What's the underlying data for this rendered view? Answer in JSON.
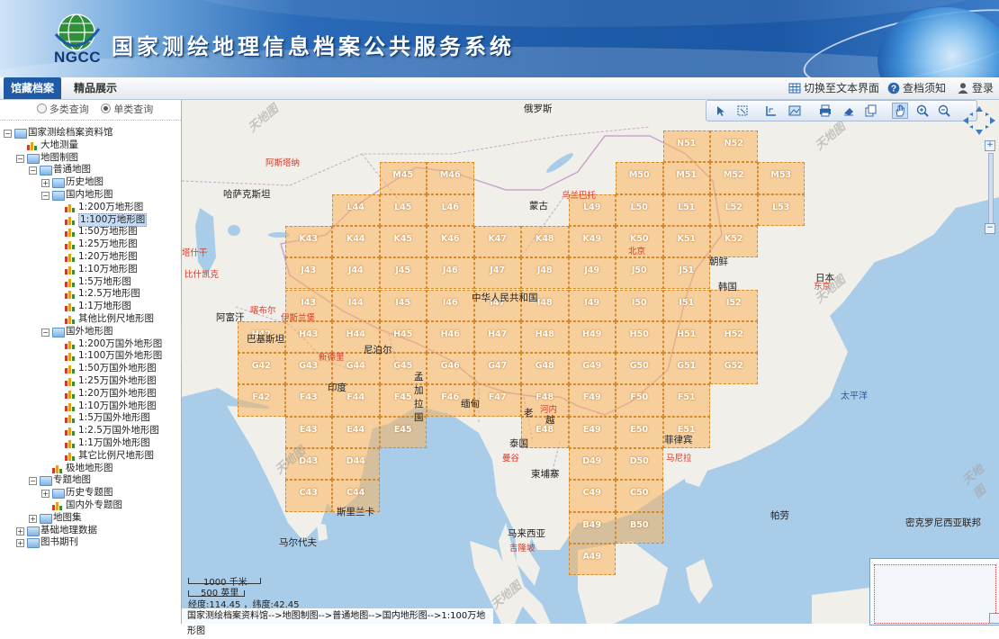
{
  "header": {
    "logo_text": "NGCC",
    "title": "国家测绘地理信息档案公共服务系统"
  },
  "nav": {
    "tabs": [
      "馆藏档案",
      "精品展示"
    ],
    "active_tab": "馆藏档案",
    "switch_text_view": "切换至文本界面",
    "notice": "查档须知",
    "login": "登录"
  },
  "query_mode": {
    "options": [
      "多类查询",
      "单类查询"
    ],
    "selected": "单类查询"
  },
  "tree": [
    {
      "label": "国家测绘档案资料馆",
      "depth": 0,
      "type": "folder",
      "expander": "−"
    },
    {
      "label": "大地测量",
      "depth": 1,
      "type": "map"
    },
    {
      "label": "地图制图",
      "depth": 1,
      "type": "folder",
      "expander": "−"
    },
    {
      "label": "普通地图",
      "depth": 2,
      "type": "folder",
      "expander": "−"
    },
    {
      "label": "历史地图",
      "depth": 3,
      "type": "folder",
      "expander": "+"
    },
    {
      "label": "国内地形图",
      "depth": 3,
      "type": "folder",
      "expander": "−"
    },
    {
      "label": "1:200万地形图",
      "depth": 4,
      "type": "map"
    },
    {
      "label": "1:100万地形图",
      "depth": 4,
      "type": "map",
      "selected": true
    },
    {
      "label": "1:50万地形图",
      "depth": 4,
      "type": "map"
    },
    {
      "label": "1:25万地形图",
      "depth": 4,
      "type": "map"
    },
    {
      "label": "1:20万地形图",
      "depth": 4,
      "type": "map"
    },
    {
      "label": "1:10万地形图",
      "depth": 4,
      "type": "map"
    },
    {
      "label": "1:5万地形图",
      "depth": 4,
      "type": "map"
    },
    {
      "label": "1:2.5万地形图",
      "depth": 4,
      "type": "map"
    },
    {
      "label": "1:1万地形图",
      "depth": 4,
      "type": "map"
    },
    {
      "label": "其他比例尺地形图",
      "depth": 4,
      "type": "map"
    },
    {
      "label": "国外地形图",
      "depth": 3,
      "type": "folder",
      "expander": "−"
    },
    {
      "label": "1:200万国外地形图",
      "depth": 4,
      "type": "map"
    },
    {
      "label": "1:100万国外地形图",
      "depth": 4,
      "type": "map"
    },
    {
      "label": "1:50万国外地形图",
      "depth": 4,
      "type": "map"
    },
    {
      "label": "1:25万国外地形图",
      "depth": 4,
      "type": "map"
    },
    {
      "label": "1:20万国外地形图",
      "depth": 4,
      "type": "map"
    },
    {
      "label": "1:10万国外地形图",
      "depth": 4,
      "type": "map"
    },
    {
      "label": "1:5万国外地形图",
      "depth": 4,
      "type": "map"
    },
    {
      "label": "1:2.5万国外地形图",
      "depth": 4,
      "type": "map"
    },
    {
      "label": "1:1万国外地形图",
      "depth": 4,
      "type": "map"
    },
    {
      "label": "其它比例尺地形图",
      "depth": 4,
      "type": "map"
    },
    {
      "label": "极地地形图",
      "depth": 3,
      "type": "map"
    },
    {
      "label": "专题地图",
      "depth": 2,
      "type": "folder",
      "expander": "−"
    },
    {
      "label": "历史专题图",
      "depth": 3,
      "type": "folder",
      "expander": "+"
    },
    {
      "label": "国内外专题图",
      "depth": 3,
      "type": "map"
    },
    {
      "label": "地图集",
      "depth": 2,
      "type": "folder",
      "expander": "+"
    },
    {
      "label": "基础地理数据",
      "depth": 1,
      "type": "folder",
      "expander": "+"
    },
    {
      "label": "图书期刊",
      "depth": 1,
      "type": "folder",
      "expander": "+"
    }
  ],
  "map": {
    "sheet_rows": [
      {
        "row": "N",
        "cols": [
          51,
          52
        ]
      },
      {
        "row": "M",
        "cols": [
          45,
          46,
          50,
          51,
          52,
          53
        ]
      },
      {
        "row": "L",
        "cols": [
          44,
          45,
          46,
          49,
          50,
          51,
          52,
          53
        ]
      },
      {
        "row": "K",
        "cols": [
          43,
          44,
          45,
          46,
          47,
          48,
          49,
          50,
          51,
          52
        ]
      },
      {
        "row": "J",
        "cols": [
          43,
          44,
          45,
          46,
          47,
          48,
          49,
          50,
          51
        ]
      },
      {
        "row": "I",
        "cols": [
          43,
          44,
          45,
          46,
          47,
          48,
          49,
          50,
          51,
          52
        ]
      },
      {
        "row": "H",
        "cols": [
          42,
          43,
          44,
          45,
          46,
          47,
          48,
          49,
          50,
          51,
          52
        ]
      },
      {
        "row": "G",
        "cols": [
          42,
          43,
          44,
          45,
          46,
          47,
          48,
          49,
          50,
          51,
          52
        ]
      },
      {
        "row": "F",
        "cols": [
          42,
          43,
          44,
          45,
          46,
          47,
          48,
          49,
          50,
          51
        ]
      },
      {
        "row": "E",
        "cols": [
          43,
          44,
          45,
          48,
          49,
          50,
          51
        ]
      },
      {
        "row": "D",
        "cols": [
          43,
          44,
          49,
          50
        ]
      },
      {
        "row": "C",
        "cols": [
          43,
          44,
          49,
          50
        ]
      },
      {
        "row": "B",
        "cols": [
          49,
          50
        ]
      },
      {
        "row": "A",
        "cols": [
          49
        ]
      }
    ],
    "place_names": {
      "russia": "俄罗斯",
      "astana": "阿斯塔纳",
      "kazakhstan": "哈萨克斯坦",
      "mongolia": "蒙古",
      "ulaanbaatar": "乌兰巴托",
      "bishkek": "比什凯克",
      "china": "中华人民共和国",
      "beijing": "北京",
      "korea": "朝鲜",
      "rok": "韩国",
      "japan": "日本",
      "tokyo": "东京",
      "afghanistan": "阿富汗",
      "kabul": "喀布尔",
      "islamabad": "伊斯兰堡",
      "pakistan": "巴基斯坦",
      "nepal": "尼泊尔",
      "india": "印度",
      "bangladesh": "孟加拉国",
      "myanmar": "缅甸",
      "thailand": "泰国",
      "bangkok": "曼谷",
      "cambodia": "柬埔寨",
      "philippines": "菲律宾",
      "malaysia": "马来西亚",
      "kualalumpur": "吉隆坡",
      "srilanka": "斯里兰卡",
      "maldives": "马尔代夫",
      "pacific": "太平洋",
      "palau": "帕劳",
      "micronesia": "密克罗尼西亚联邦",
      "newdelhi": "新德里",
      "hanoi": "河内",
      "laos": "老",
      "vietnam": "越",
      "manila": "马尼拉",
      "tashkent": "塔什干"
    },
    "watermark": "天地图",
    "scale_km": "1000 千米",
    "scale_mi": "500 英里",
    "coords_label": "经度:114.45 ，纬度:42.45",
    "breadcrumb": "国家测绘档案资料馆-->地图制图-->普通地图-->国内地形图-->1:100万地形图"
  },
  "colors": {
    "header_blue": "#1d5aa7",
    "sheet_fill": "#fab55e",
    "sea": "#a9cce9",
    "land": "#f1efe9"
  }
}
